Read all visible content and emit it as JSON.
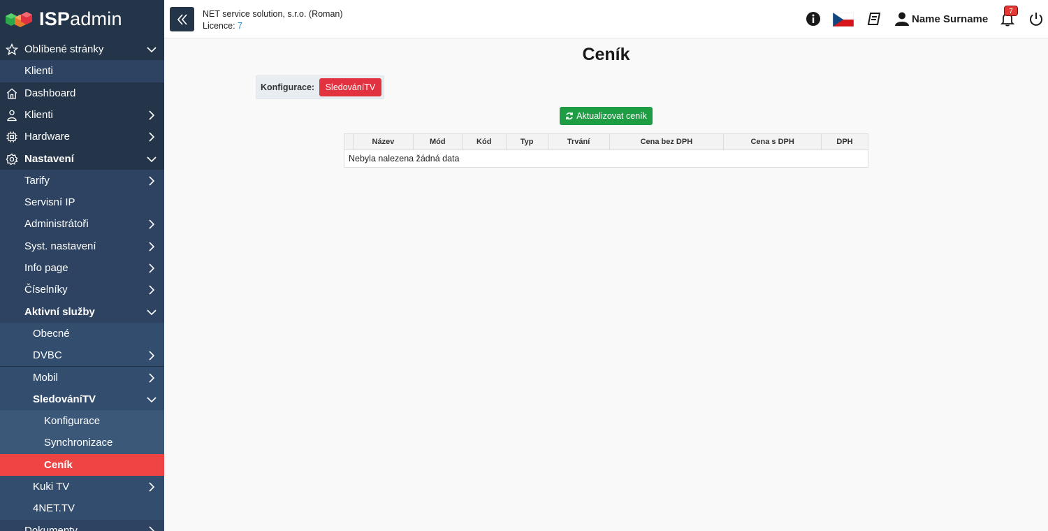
{
  "app": {
    "logo_bold": "ISP",
    "logo_light": "admin"
  },
  "sidebar": {
    "favorites": {
      "label": "Oblíbené stránky",
      "icon": "star-icon"
    },
    "favorites_items": [
      {
        "label": "Klienti"
      }
    ],
    "items": [
      {
        "label": "Dashboard",
        "icon": "home-icon"
      },
      {
        "label": "Klienti",
        "icon": "user-icon"
      },
      {
        "label": "Hardware",
        "icon": "chip-icon"
      },
      {
        "label": "Nastavení",
        "icon": "gear-icon"
      }
    ],
    "settings_items": [
      {
        "label": "Tarify"
      },
      {
        "label": "Servisní IP"
      },
      {
        "label": "Administrátoři"
      },
      {
        "label": "Syst. nastavení"
      },
      {
        "label": "Info page"
      },
      {
        "label": "Číselníky"
      },
      {
        "label": "Aktivní služby"
      }
    ],
    "services_items": [
      {
        "label": "Obecné"
      },
      {
        "label": "DVBC"
      },
      {
        "label": "Mobil"
      },
      {
        "label": "SledováníTV"
      }
    ],
    "sledovani_items": [
      {
        "label": "Konfigurace"
      },
      {
        "label": "Synchronizace"
      },
      {
        "label": "Ceník"
      }
    ],
    "services_more": [
      {
        "label": "Kuki TV"
      },
      {
        "label": "4NET.TV"
      }
    ],
    "bottom_item": {
      "label": "Dokumenty"
    }
  },
  "header": {
    "company": "NET service solution, s.r.o. (Roman)",
    "licence_label": "Licence:",
    "licence_value": "7",
    "user_name": "Name Surname",
    "notifications_count": "7",
    "language_flag": "cz-flag-icon"
  },
  "main": {
    "title": "Ceník",
    "config_label": "Konfigurace:",
    "config_value": "SledováníTV",
    "update_button": "Aktualizovat ceník",
    "table": {
      "columns": [
        "",
        "Název",
        "Mód",
        "Kód",
        "Typ",
        "Trvání",
        "Cena bez DPH",
        "Cena s DPH",
        "DPH"
      ],
      "empty_message": "Nebyla nalezena žádná data"
    }
  },
  "colors": {
    "sidebar": "#243549",
    "active": "#ef4444",
    "update_button": "#1f9d45",
    "config_button": "#e3323f"
  }
}
